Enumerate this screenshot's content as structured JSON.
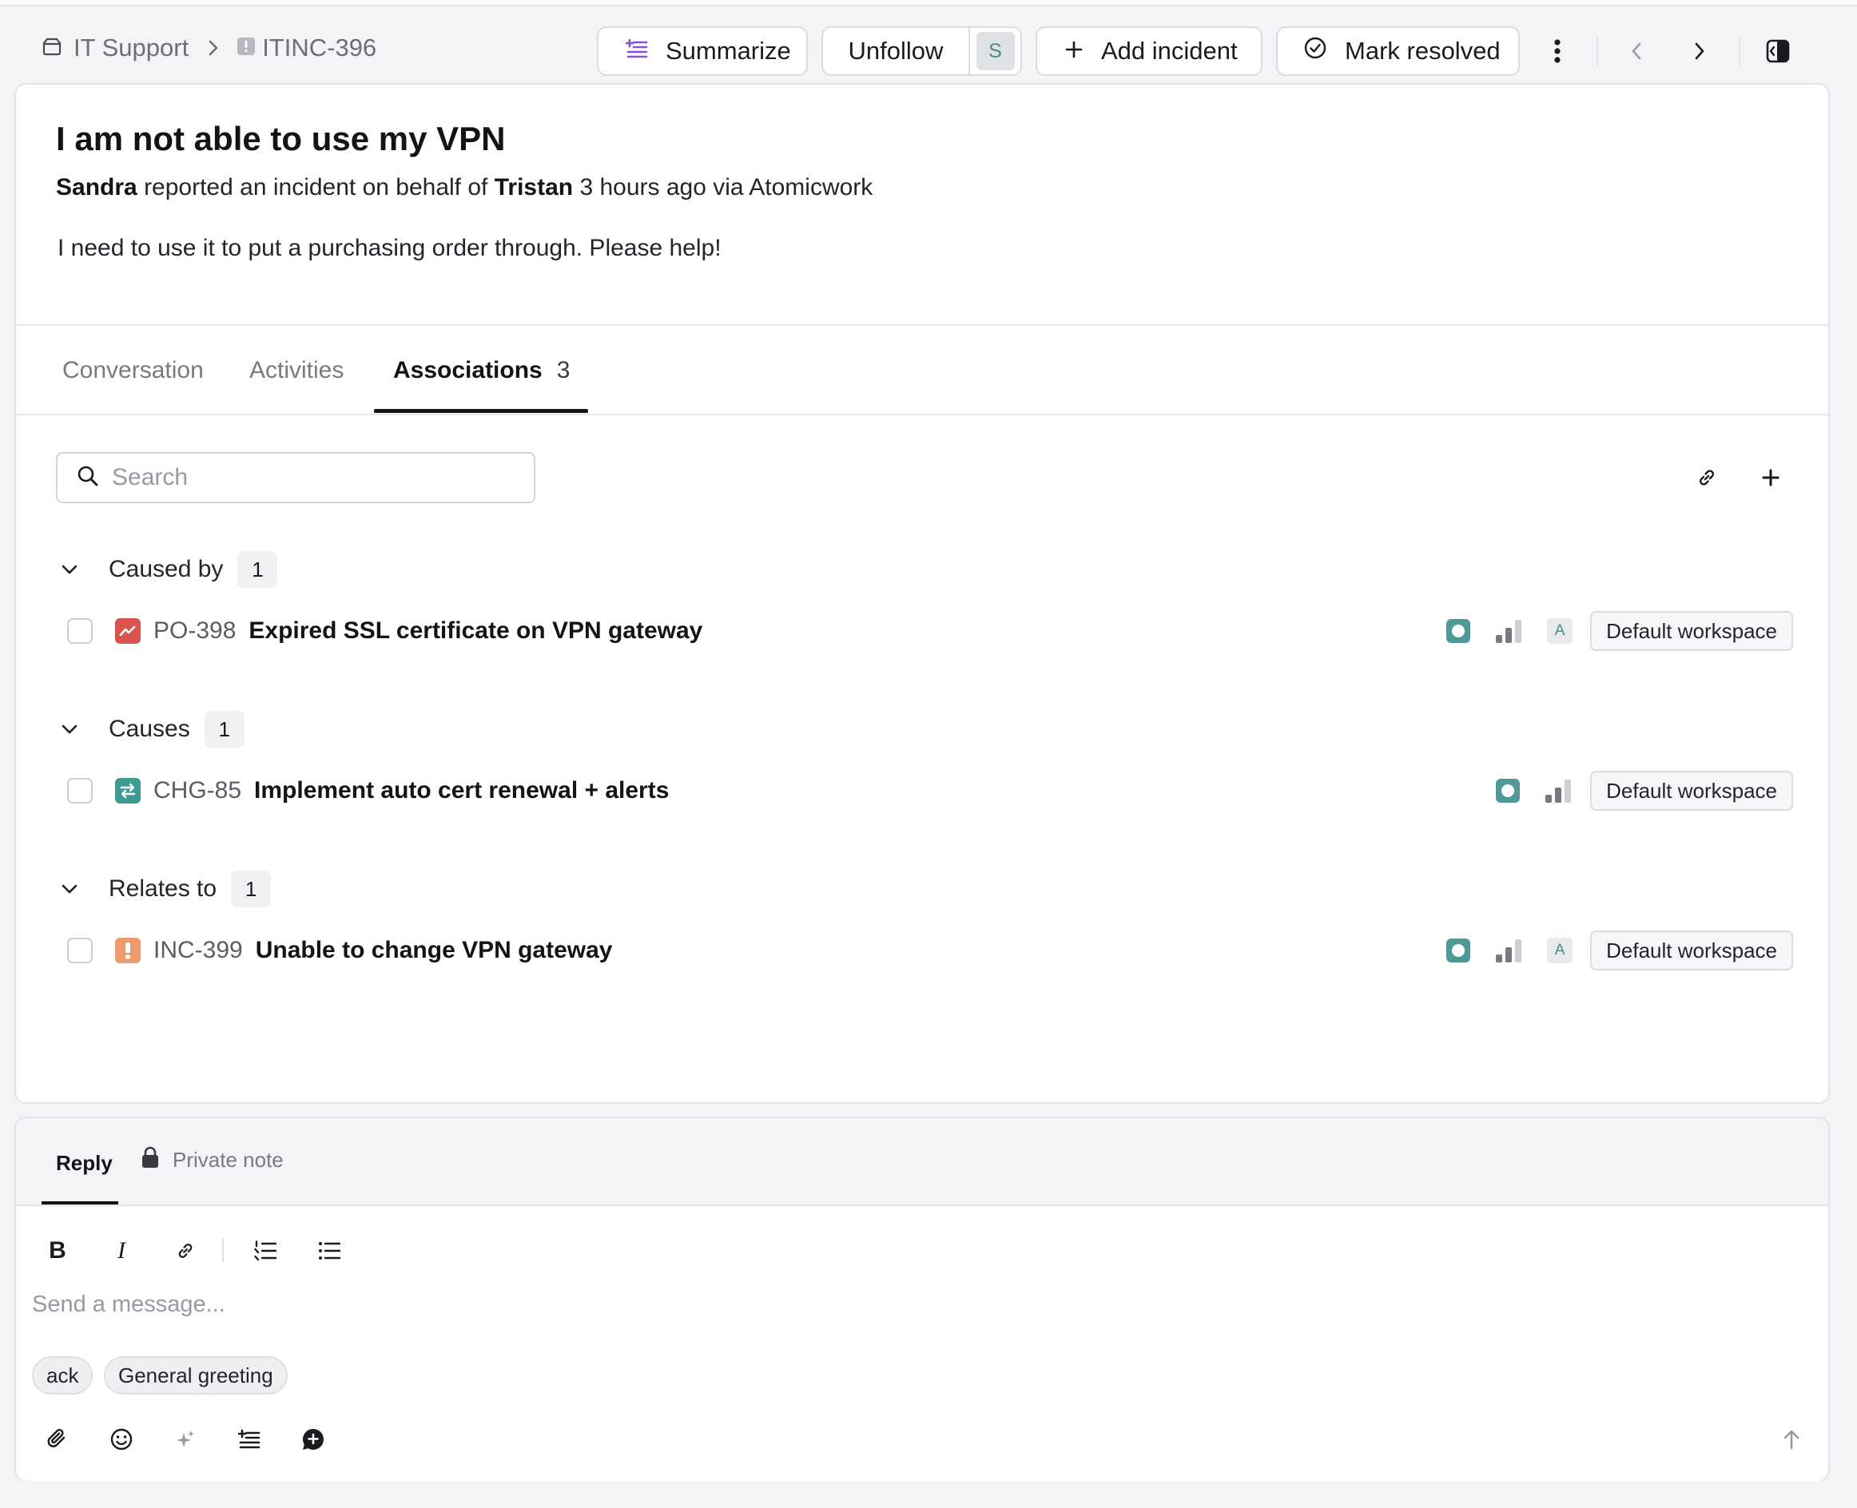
{
  "breadcrumb": {
    "parent": "IT Support",
    "current": "ITINC-396"
  },
  "toolbar": {
    "summarize": "Summarize",
    "unfollow": "Unfollow",
    "follower_avatar": "S",
    "add_incident": "Add incident",
    "mark_resolved": "Mark resolved"
  },
  "incident": {
    "title": "I am not able to use my VPN",
    "reporter": "Sandra",
    "reported_text": "reported an incident on behalf of",
    "requester": "Tristan",
    "time_text": "3 hours ago",
    "via_text": "via Atomicwork",
    "description": "I need to use it to put a purchasing order through. Please help!"
  },
  "tabs": {
    "conversation": "Conversation",
    "activities": "Activities",
    "associations": "Associations",
    "associations_count": "3"
  },
  "search": {
    "placeholder": "Search"
  },
  "groups": [
    {
      "name": "Caused by",
      "count": "1",
      "item": {
        "id": "PO-398",
        "title": "Expired SSL certificate on VPN gateway",
        "type_icon": "problem-icon",
        "type_color": "#d9534f",
        "assignee": "A",
        "workspace": "Default workspace"
      }
    },
    {
      "name": "Causes",
      "count": "1",
      "item": {
        "id": "CHG-85",
        "title": "Implement auto cert renewal + alerts",
        "type_icon": "change-icon",
        "type_color": "#3e9b92",
        "assignee": "",
        "workspace": "Default workspace"
      }
    },
    {
      "name": "Relates to",
      "count": "1",
      "item": {
        "id": "INC-399",
        "title": "Unable to change VPN gateway",
        "type_icon": "incident-icon",
        "type_color": "#ef9a6b",
        "assignee": "A",
        "workspace": "Default workspace"
      }
    }
  ],
  "reply": {
    "tab_reply": "Reply",
    "tab_private": "Private note",
    "placeholder": "Send a message...",
    "chips": [
      "ack",
      "General greeting"
    ]
  },
  "colors": {
    "status": "#4f9a98",
    "accent_purple": "#8b4fd0"
  }
}
